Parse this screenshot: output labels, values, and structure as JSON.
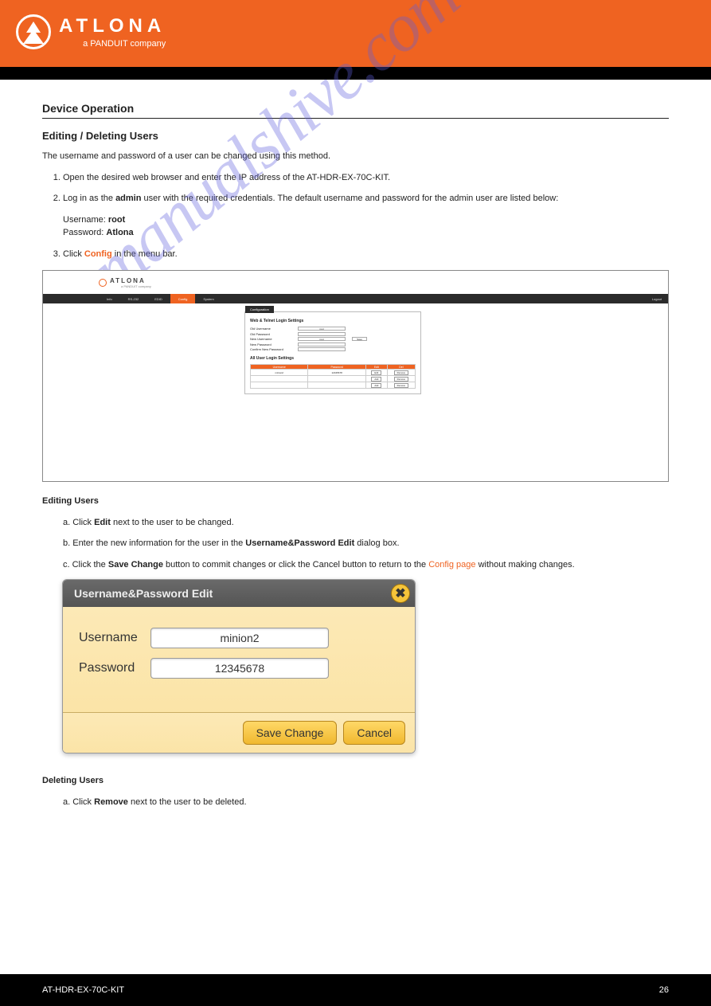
{
  "header": {
    "brand": "ATLONA",
    "brand_sub": "a PANDUIT company"
  },
  "page": {
    "section_title": "Device Operation",
    "subsection_title": "Editing / Deleting Users",
    "intro": "The username and password of a user can be changed using this method.",
    "steps": [
      {
        "n": "1",
        "text": "Open the desired web browser and enter the IP address of the AT-HDR-EX-70C-KIT."
      },
      {
        "n": "2",
        "text_pre": "Log in as the ",
        "text_bold": "admin",
        "text_mid": " user with the required credentials. The default username and password for the admin user are listed below:",
        "creds_user_lbl": "Username:",
        "creds_user_val": "root",
        "creds_pass_lbl": "Password:",
        "creds_pass_val": "Atlona"
      },
      {
        "n": "3",
        "text_pre": "Click ",
        "text_link": "Config",
        "text_post": " in the menu bar."
      }
    ]
  },
  "ss": {
    "brand": "ATLONA",
    "brand_sub": "a PANDUIT company",
    "nav": [
      "Info",
      "RS-232",
      "EDID",
      "Config",
      "System"
    ],
    "nav_right": "Logout",
    "config_tab": "Configuration",
    "panel_title1": "Web & Telnet Login Settings",
    "labels": {
      "old_user": "Old Username",
      "old_pass": "Old Password",
      "new_user": "New Username",
      "new_pass": "New Password",
      "conf_pass": "Confirm New Password"
    },
    "vals": {
      "old_user": "root",
      "new_user": "root"
    },
    "save_btn": "Save",
    "panel_title2": "All User Login Settings",
    "table_headers": [
      "Username",
      "Password",
      "Edit",
      "Del"
    ],
    "table_rows": [
      {
        "u": "minion2",
        "p": "12345678",
        "edit": "Edit",
        "del": "Remove"
      },
      {
        "u": "",
        "p": "",
        "edit": "Add",
        "del": "Remove"
      },
      {
        "u": "",
        "p": "",
        "edit": "Add",
        "del": "Remove"
      }
    ]
  },
  "editing": {
    "heading": "Editing Users",
    "lead_items": [
      {
        "pre": "a. Click ",
        "bold": "Edit",
        "post": " next to the user to be changed."
      },
      {
        "pre": "b. Enter the new information for the user in the ",
        "bold": "Username&Password Edit",
        "post": " dialog box."
      },
      {
        "pre": "c. Click the ",
        "bold": "Save Change",
        "post": " button to commit changes or click the Cancel button to return to the ",
        "link": "Config page",
        "tail": " without making changes."
      }
    ]
  },
  "dialog": {
    "title": "Username&Password Edit",
    "user_label": "Username",
    "user_value": "minion2",
    "pass_label": "Password",
    "pass_value": "12345678",
    "save_btn": "Save Change",
    "cancel_btn": "Cancel"
  },
  "deleting": {
    "heading": "Deleting Users",
    "item_pre": "a. Click ",
    "item_bold": "Remove",
    "item_post": " next to the user to be deleted."
  },
  "footer": {
    "left": "AT-HDR-EX-70C-KIT",
    "right": "26"
  },
  "watermark": "manualshive.com"
}
